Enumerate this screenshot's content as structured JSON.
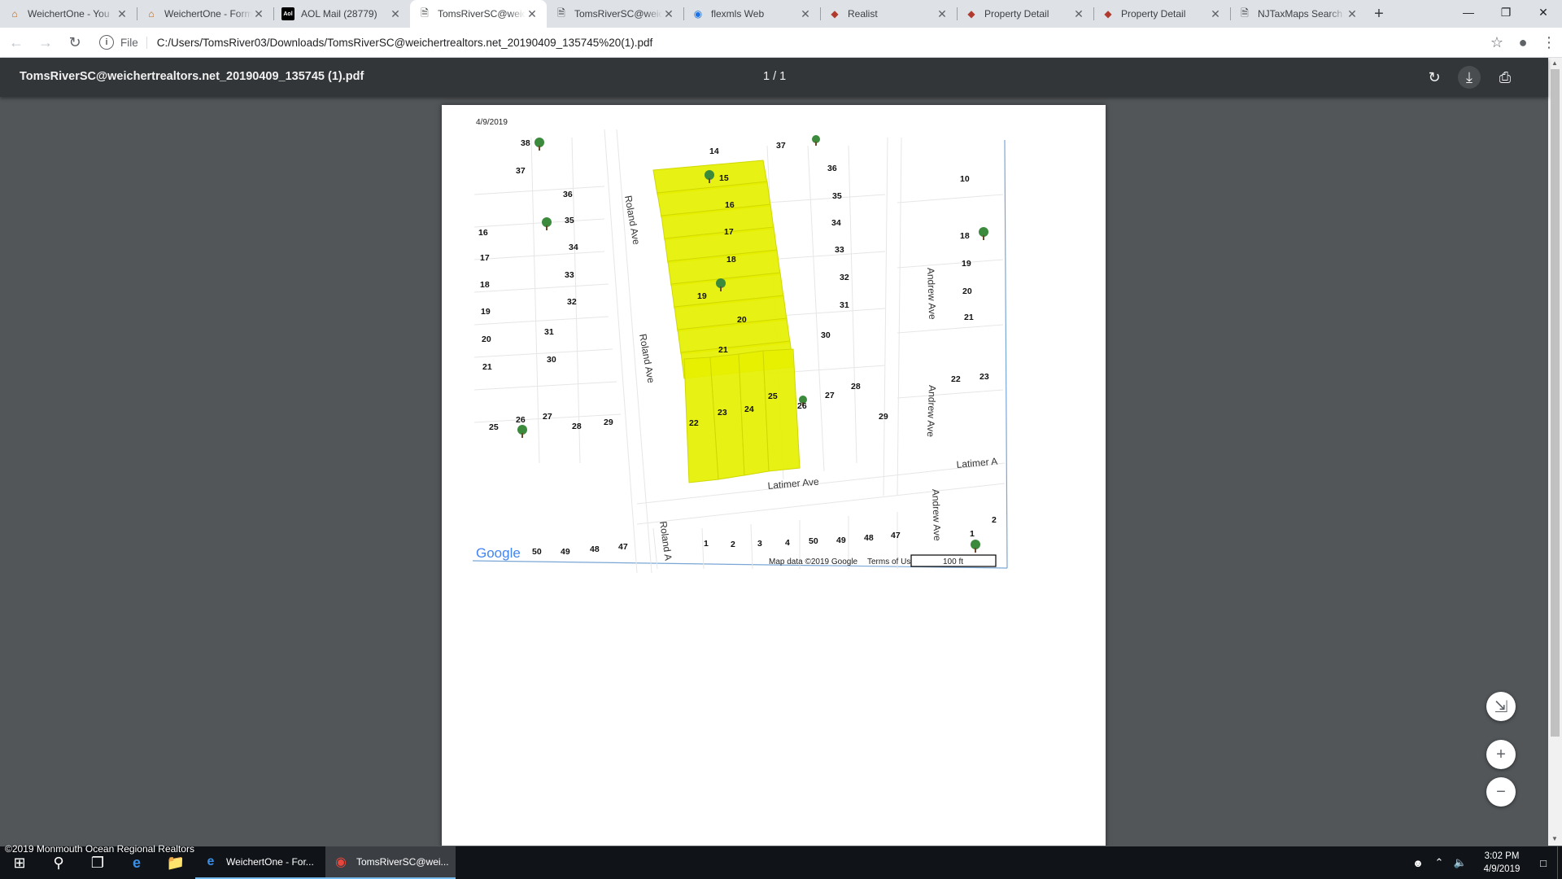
{
  "tabs": [
    {
      "title": "WeichertOne - You",
      "icon": "house-icon",
      "active": false
    },
    {
      "title": "WeichertOne - Form",
      "icon": "house-icon",
      "active": false
    },
    {
      "title": "AOL Mail (28779)",
      "icon": "aol-icon",
      "active": false
    },
    {
      "title": "TomsRiverSC@weic",
      "icon": "document-icon",
      "active": true
    },
    {
      "title": "TomsRiverSC@weic",
      "icon": "document-icon",
      "active": false
    },
    {
      "title": "flexmls Web",
      "icon": "flexmls-icon",
      "active": false
    },
    {
      "title": "Realist",
      "icon": "realist-icon",
      "active": false
    },
    {
      "title": "Property Detail",
      "icon": "realist-icon",
      "active": false
    },
    {
      "title": "Property Detail",
      "icon": "realist-icon",
      "active": false
    },
    {
      "title": "NJTaxMaps Search",
      "icon": "document-icon",
      "active": false
    }
  ],
  "address": {
    "scheme": "File",
    "url": "C:/Users/TomsRiver03/Downloads/TomsRiverSC@weichertrealtors.net_20190409_135745%20(1).pdf"
  },
  "pdf": {
    "filename": "TomsRiverSC@weichertrealtors.net_20190409_135745 (1).pdf",
    "page_indicator": "1 / 1",
    "date": "4/9/2019"
  },
  "map": {
    "streets": [
      "Roland Ave",
      "Roland Ave",
      "Roland A",
      "Andrew Ave",
      "Andrew Ave",
      "Andrew Ave",
      "Latimer Ave",
      "Latimer A"
    ],
    "attribution": "Map data ©2019 Google",
    "terms": "Terms of Us",
    "scale": "100 ft",
    "logo": "Google",
    "lots": [
      "38",
      "37",
      "36",
      "35",
      "34",
      "33",
      "32",
      "31",
      "30",
      "16",
      "17",
      "18",
      "19",
      "20",
      "21",
      "25",
      "26",
      "27",
      "28",
      "29",
      "14",
      "15",
      "16",
      "17",
      "18",
      "19",
      "20",
      "21",
      "22",
      "23",
      "24",
      "25",
      "26",
      "37",
      "36",
      "35",
      "34",
      "33",
      "32",
      "31",
      "30",
      "27",
      "28",
      "29",
      "10",
      "18",
      "19",
      "20",
      "21",
      "22",
      "23",
      "50",
      "49",
      "48",
      "47",
      "1",
      "2",
      "3",
      "4",
      "50",
      "49",
      "48",
      "47",
      "1",
      "2"
    ]
  },
  "watermark": "©2019 Monmouth Ocean Regional Realtors",
  "taskbar": {
    "apps": [
      {
        "label": "WeichertOne - For...",
        "icon": "ie-icon",
        "active": false
      },
      {
        "label": "TomsRiverSC@wei...",
        "icon": "chrome-icon",
        "active": true
      }
    ],
    "time": "3:02 PM",
    "date": "4/9/2019"
  }
}
